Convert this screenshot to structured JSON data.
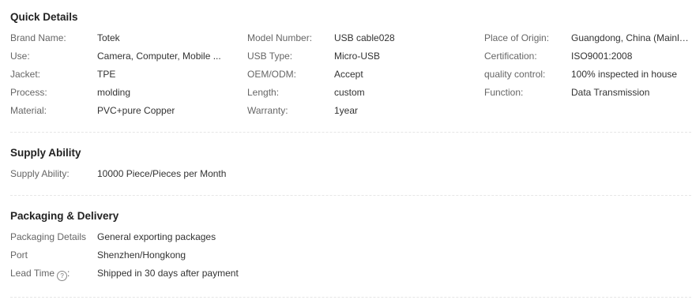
{
  "quick_details": {
    "title": "Quick Details",
    "items": [
      {
        "label": "Brand Name:",
        "value": "Totek"
      },
      {
        "label": "Model Number:",
        "value": "USB cable028"
      },
      {
        "label": "Place of Origin:",
        "value": "Guangdong, China (Mainlan..."
      },
      {
        "label": "Use:",
        "value": "Camera, Computer, Mobile ..."
      },
      {
        "label": "USB Type:",
        "value": "Micro-USB"
      },
      {
        "label": "Certification:",
        "value": "ISO9001:2008"
      },
      {
        "label": "Jacket:",
        "value": "TPE"
      },
      {
        "label": "OEM/ODM:",
        "value": "Accept"
      },
      {
        "label": "quality control:",
        "value": "100% inspected in house"
      },
      {
        "label": "Process:",
        "value": "molding"
      },
      {
        "label": "Length:",
        "value": "custom"
      },
      {
        "label": "Function:",
        "value": "Data Transmission"
      },
      {
        "label": "Material:",
        "value": "PVC+pure Copper"
      },
      {
        "label": "Warranty:",
        "value": "1year"
      }
    ]
  },
  "supply_ability": {
    "title": "Supply Ability",
    "items": [
      {
        "label": "Supply Ability:",
        "value": "10000 Piece/Pieces per Month"
      }
    ]
  },
  "packaging_delivery": {
    "title": "Packaging & Delivery",
    "items": [
      {
        "label": "Packaging Details",
        "value": "General exporting packages"
      },
      {
        "label": "Port",
        "value": "Shenzhen/Hongkong"
      },
      {
        "label": "Lead Time",
        "value": "Shipped in 30 days after payment",
        "icon": "question-circle-icon",
        "icon_glyph": "?",
        "label_suffix": ":"
      }
    ]
  }
}
